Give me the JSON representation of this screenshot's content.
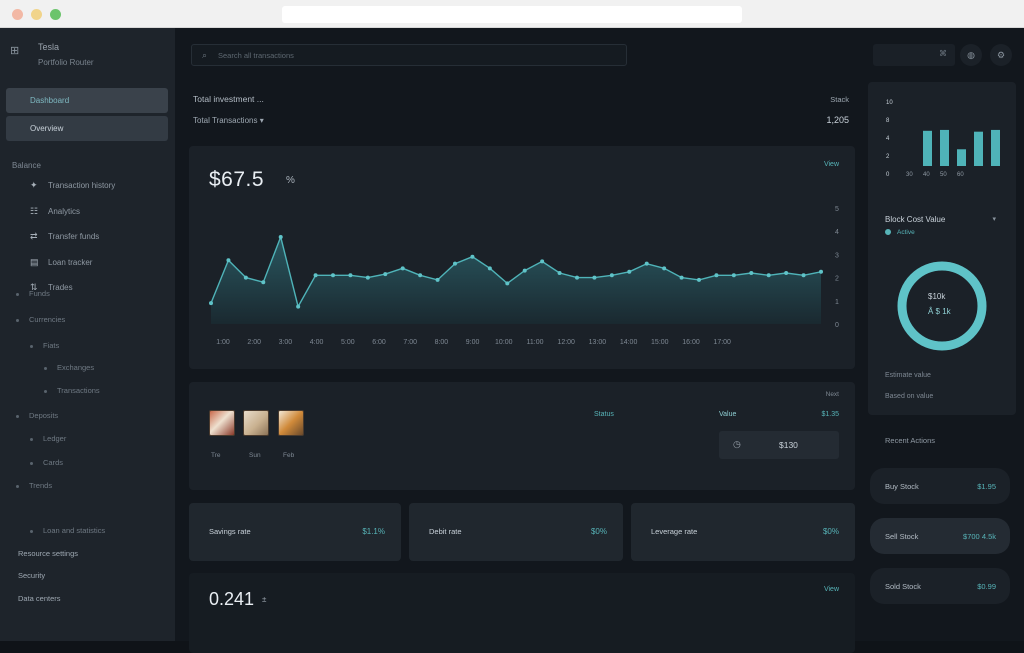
{
  "brand": {
    "icon": "grid-icon",
    "title": "Tesla",
    "subtitle": "Portfolio Router"
  },
  "sidebar": {
    "buttons": [
      "Dashboard",
      "Overview"
    ],
    "section": "Balance",
    "nav": [
      {
        "icon": "✦",
        "label": "Transaction history"
      },
      {
        "icon": "☷",
        "label": "Analytics"
      },
      {
        "icon": "⇄",
        "label": "Transfer funds"
      },
      {
        "icon": "▤",
        "label": "Loan tracker"
      },
      {
        "icon": "⇅",
        "label": "Trades"
      }
    ],
    "tree": [
      {
        "label": "Funds",
        "indent": 0,
        "icon": "▦"
      },
      {
        "label": "Currencies",
        "indent": 0
      },
      {
        "label": "Fiats",
        "indent": 1
      },
      {
        "label": "Exchanges",
        "indent": 2
      },
      {
        "label": "Transactions",
        "indent": 2
      },
      {
        "label": "Deposits",
        "indent": 0
      },
      {
        "label": "Ledger",
        "indent": 1
      },
      {
        "label": "Cards",
        "indent": 1
      },
      {
        "label": "Trends",
        "indent": 0
      },
      {
        "label": "Loan and statistics",
        "indent": 1
      },
      {
        "label": "Resource settings",
        "indent": -1
      },
      {
        "label": "Security",
        "indent": -0.5
      },
      {
        "label": "Data centers",
        "indent": -0.5
      }
    ]
  },
  "search": {
    "icon": "search-icon",
    "placeholder": "Search all transactions"
  },
  "topbar": {
    "box_icon": "⌘",
    "btn1_icon": "◍",
    "btn2_icon": "⚙"
  },
  "header": {
    "line1": "Total investment ...",
    "line2": "Total Transactions ▾",
    "right1": "Stack",
    "right2": "1,205"
  },
  "chart_data": {
    "type": "area",
    "title": "$67.5",
    "subtitle": "%",
    "badge": "View",
    "x": [
      "1:00",
      "2:00",
      "3:00",
      "4:00",
      "5:00",
      "6:00",
      "7:00",
      "8:00",
      "9:00",
      "10:00",
      "11:00",
      "12:00",
      "13:00",
      "14:00",
      "15:00",
      "16:00",
      "17:00"
    ],
    "series": [
      {
        "name": "",
        "values": [
          18,
          55,
          40,
          36,
          75,
          15,
          42,
          42,
          42,
          40,
          43,
          48,
          42,
          38,
          52,
          58,
          48,
          35,
          46,
          54,
          44,
          40,
          40,
          42,
          45,
          52,
          48,
          40,
          38,
          42,
          42,
          44,
          42,
          44,
          42,
          45
        ]
      }
    ],
    "yticks": [
      "0",
      "1",
      "2",
      "3",
      "4",
      "5"
    ],
    "ylim": [
      0,
      100
    ]
  },
  "middle": {
    "thumbs": [
      "Tre",
      "Sun",
      "Feb"
    ],
    "col1": "Status",
    "col2": "Value",
    "col3": "$1.35",
    "top_right": "Next",
    "pill_icon": "◷",
    "pill_value": "$130"
  },
  "stats": [
    {
      "label": "Savings rate",
      "value": "$1.1%"
    },
    {
      "label": "Debit rate",
      "value": "$0%"
    },
    {
      "label": "Leverage rate",
      "value": "$0%"
    }
  ],
  "bottom": {
    "value": "0.241",
    "sub": "±",
    "right": "View"
  },
  "right_panel": {
    "mini_y": [
      "10",
      "8",
      "4",
      "2",
      "0"
    ],
    "mini_x": [
      "30",
      "40",
      "50",
      "60"
    ],
    "mini_values": [
      0,
      80,
      82,
      38,
      78,
      82
    ],
    "title": "Block Cost Value",
    "legend": "Active",
    "donut_percent": 100,
    "donut_line1": "$10k",
    "donut_line2": "Â $ 1k",
    "foot1": "Estimate value",
    "foot2": "Based on value"
  },
  "right_list": {
    "label": "Recent Actions",
    "items": [
      {
        "label": "Buy Stock",
        "value": "$1.95"
      },
      {
        "label": "Sell Stock",
        "value": "$700 4.5k"
      },
      {
        "label": "Sold Stock",
        "value": "$0.99"
      }
    ]
  },
  "colors": {
    "accent": "#57b4b8",
    "bg": "#12171d",
    "card": "#1b2128"
  }
}
